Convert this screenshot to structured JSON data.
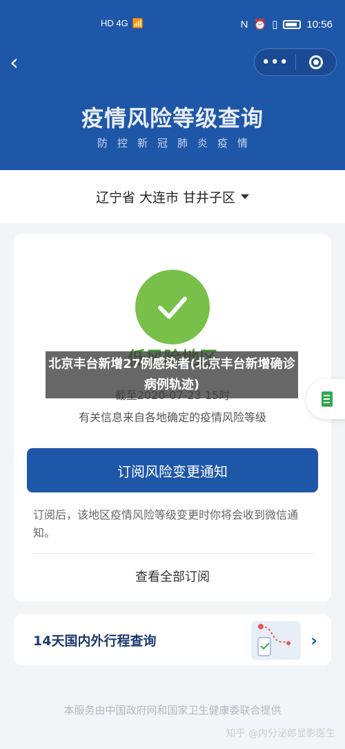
{
  "status_bar": {
    "network": "HD 4G",
    "time": "10:56"
  },
  "header": {
    "title": "疫情风险等级查询",
    "subtitle": "防控新冠肺炎疫情"
  },
  "region": {
    "label": "辽宁省 大连市 甘井子区"
  },
  "card": {
    "risk_level": "低风险地区",
    "as_of": "截至2020-07-23 15时",
    "info_source": "有关信息来自各地确定的疫情风险等级",
    "subscribe_button": "订阅风险变更通知",
    "subscribe_desc": "订阅后，该地区疫情风险等级变更时你将会收到微信通知。",
    "view_all": "查看全部订阅"
  },
  "itinerary": {
    "label": "14天国内外行程查询"
  },
  "footer": {
    "text": "本服务由中国政府网和国家卫生健康委联合提供",
    "watermark": "知乎 @内分泌郎显影医生"
  },
  "overlay": {
    "text": "北京丰台新增27例感染者(北京丰台新增确诊病例轨迹)"
  },
  "colors": {
    "brand": "#1f57a8",
    "low_risk": "#78c04a"
  }
}
